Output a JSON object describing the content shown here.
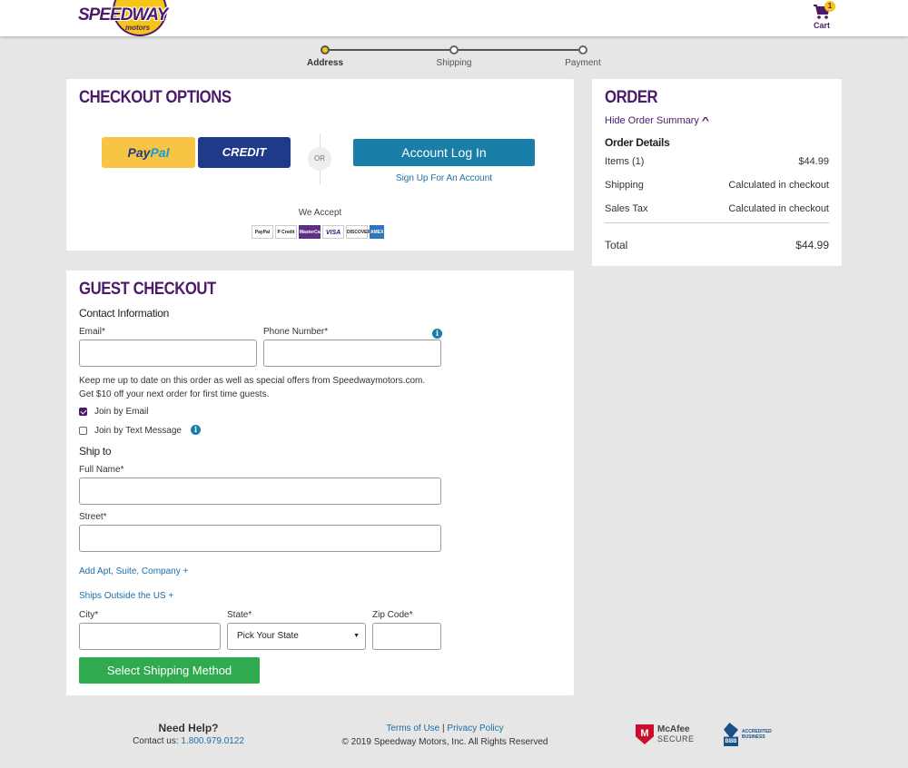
{
  "header": {
    "logo_text": "SPEEDWAY",
    "logo_sub": "motors",
    "cart_label": "Cart",
    "cart_count": "1"
  },
  "progress": {
    "steps": [
      {
        "label": "Address",
        "active": true
      },
      {
        "label": "Shipping",
        "active": false
      },
      {
        "label": "Payment",
        "active": false
      }
    ]
  },
  "checkout_options": {
    "title": "CHECKOUT OPTIONS",
    "paypal_label_1": "Pay",
    "paypal_label_2": "Pal",
    "credit_label": "CREDIT",
    "or_label": "OR",
    "login_label": "Account Log In",
    "signup_label": "Sign Up For An Account",
    "we_accept": "We Accept",
    "payment_methods": [
      {
        "icon": "paypal-icon",
        "text": "PayPal"
      },
      {
        "icon": "paypal-credit-icon",
        "text": "P Credit"
      },
      {
        "icon": "mastercard-icon",
        "text": "MasterCard"
      },
      {
        "icon": "visa-icon",
        "text": "VISA"
      },
      {
        "icon": "discover-icon",
        "text": "DISCOVER"
      },
      {
        "icon": "amex-icon",
        "text": "AMEX"
      }
    ]
  },
  "order": {
    "title": "ORDER",
    "hide_summary": "Hide Order Summary",
    "details_title": "Order Details",
    "rows": [
      {
        "label": "Items (1)",
        "value": "$44.99"
      },
      {
        "label": "Shipping",
        "value": "Calculated in checkout"
      },
      {
        "label": "Sales Tax",
        "value": "Calculated in checkout"
      }
    ],
    "total_label": "Total",
    "total_value": "$44.99"
  },
  "guest": {
    "title": "GUEST CHECKOUT",
    "contact_title": "Contact Information",
    "email_label": "Email*",
    "phone_label": "Phone Number*",
    "promo_line1": "Keep me up to date on this order as well as special offers from Speedwaymotors.com.",
    "promo_line2": "Get $10 off your next order for first time guests.",
    "join_email": "Join by Email",
    "join_email_checked": true,
    "join_text": "Join by Text Message",
    "join_text_checked": false,
    "ship_to_title": "Ship to",
    "full_name_label": "Full Name*",
    "street_label": "Street*",
    "add_apt_link": "Add Apt, Suite, Company  +",
    "ships_outside_link": "Ships Outside the US  +",
    "city_label": "City*",
    "state_label": "State*",
    "state_value": "Pick Your State",
    "zip_label": "Zip Code*",
    "submit_label": "Select Shipping Method"
  },
  "footer": {
    "help_title": "Need Help?",
    "contact_prefix": "Contact us: ",
    "phone": "1.800.979.0122",
    "terms": "Terms of Use",
    "separator": "|",
    "privacy": "Privacy Policy",
    "copyright": "© 2019 Speedway Motors, Inc. All Rights Reserved",
    "mcafee_1": "McAfee",
    "mcafee_2": "SECURE",
    "bbb_mark": "BBB",
    "bbb_1": "ACCREDITED",
    "bbb_2": "BUSINESS"
  },
  "colors": {
    "brand_purple": "#4b1a6b",
    "brand_yellow": "#f5c518",
    "link_blue": "#1a6fa8",
    "primary_button": "#1a7fa8",
    "success_button": "#2faa4f"
  }
}
